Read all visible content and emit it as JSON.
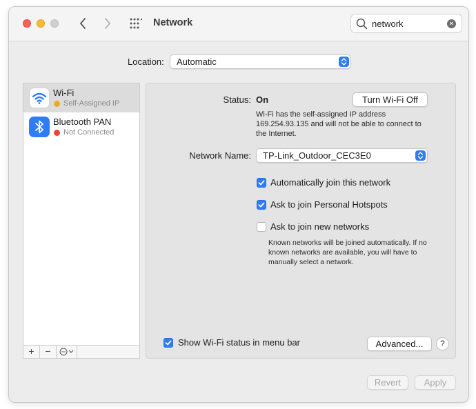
{
  "window": {
    "title": "Network",
    "search": {
      "value": "network",
      "clear_glyph": "×"
    }
  },
  "location": {
    "label": "Location:",
    "value": "Automatic"
  },
  "services": [
    {
      "name": "Wi-Fi",
      "status": "Self-Assigned IP",
      "status_color": "#f5a623",
      "icon": "wifi-icon",
      "selected": true
    },
    {
      "name": "Bluetooth PAN",
      "status": "Not Connected",
      "status_color": "#e8443a",
      "icon": "bluetooth-icon",
      "selected": false
    }
  ],
  "list_controls": {
    "add": "+",
    "remove": "−"
  },
  "detail": {
    "status_label": "Status:",
    "status_value": "On",
    "turn_off_button": "Turn Wi-Fi Off",
    "status_description": "Wi-Fi has the self-assigned IP address 169.254.93.135 and will not be able to connect to the Internet.",
    "network_name_label": "Network Name:",
    "network_name_value": "TP-Link_Outdoor_CEC3E0",
    "auto_join": {
      "label": "Automatically join this network",
      "checked": true
    },
    "hotspots": {
      "label": "Ask to join Personal Hotspots",
      "checked": true
    },
    "new_networks": {
      "label": "Ask to join new networks",
      "checked": false
    },
    "new_networks_note": "Known networks will be joined automatically. If no known networks are available, you will have to manually select a network.",
    "show_status": {
      "label": "Show Wi-Fi status in menu bar",
      "checked": true
    },
    "advanced_button": "Advanced...",
    "help_button": "?"
  },
  "footer": {
    "revert_button": "Revert",
    "apply_button": "Apply"
  },
  "colors": {
    "accent": "#2e7cf6",
    "panel": "#e4e4e4",
    "window": "#ececec"
  }
}
